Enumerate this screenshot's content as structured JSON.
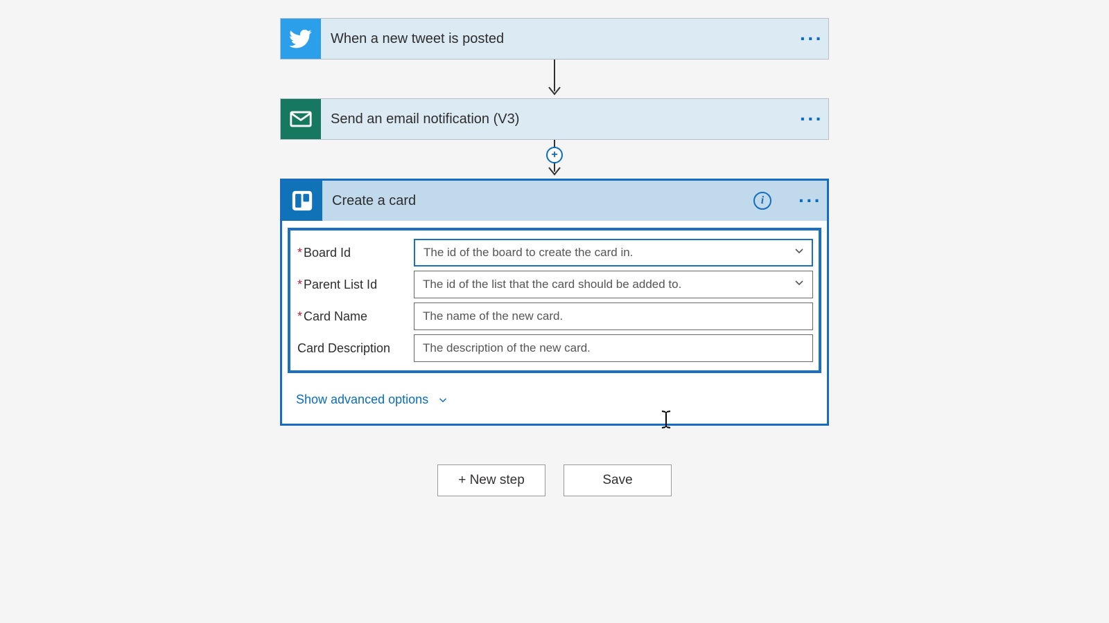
{
  "steps": {
    "twitter": {
      "title": "When a new tweet is posted"
    },
    "email": {
      "title": "Send an email notification (V3)"
    }
  },
  "expanded": {
    "title": "Create a card",
    "advanced_label": "Show advanced options",
    "rows": {
      "board": {
        "label": "Board Id",
        "placeholder": "The id of the board to create the card in."
      },
      "list": {
        "label": "Parent List Id",
        "placeholder": "The id of the list that the card should be added to."
      },
      "name": {
        "label": "Card Name",
        "placeholder": "The name of the new card."
      },
      "desc": {
        "label": "Card Description",
        "placeholder": "The description of the new card."
      }
    }
  },
  "footer": {
    "new_step": "+ New step",
    "save": "Save"
  }
}
